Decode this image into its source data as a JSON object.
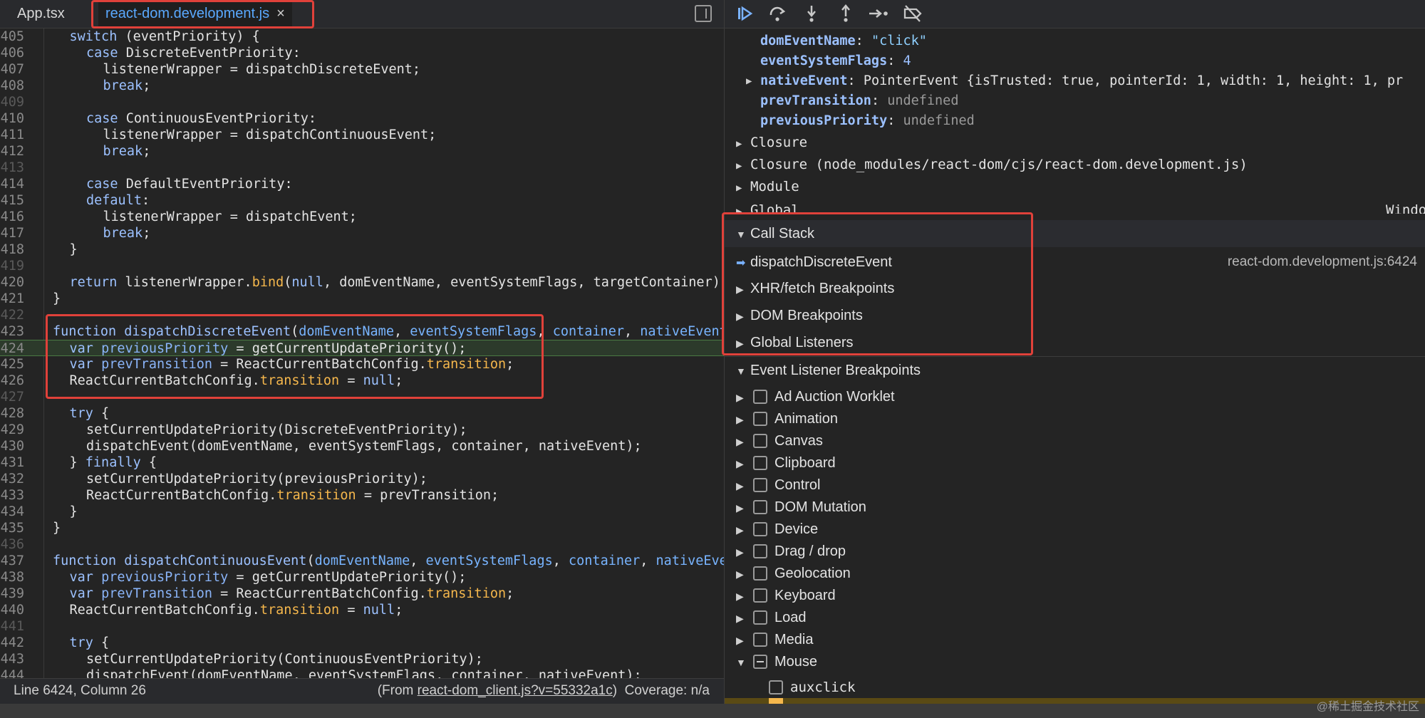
{
  "tabs": [
    {
      "label": "App.tsx"
    },
    {
      "label": "react-dom.development.js",
      "close": "×"
    }
  ],
  "code_lines": [
    {
      "n": "405",
      "html": "<span class=\"kw\">switch</span> (eventPriority) {",
      "indent": 1
    },
    {
      "n": "406",
      "html": "<span class=\"kw\">case</span> DiscreteEventPriority:",
      "indent": 2
    },
    {
      "n": "407",
      "html": "listenerWrapper = dispatchDiscreteEvent;",
      "indent": 3
    },
    {
      "n": "408",
      "html": "<span class=\"kw\">break</span>;",
      "indent": 3
    },
    {
      "n": "409",
      "html": "",
      "indent": 0,
      "dim": true
    },
    {
      "n": "410",
      "html": "<span class=\"kw\">case</span> ContinuousEventPriority:",
      "indent": 2
    },
    {
      "n": "411",
      "html": "listenerWrapper = dispatchContinuousEvent;",
      "indent": 3
    },
    {
      "n": "412",
      "html": "<span class=\"kw\">break</span>;",
      "indent": 3
    },
    {
      "n": "413",
      "html": "",
      "indent": 0,
      "dim": true
    },
    {
      "n": "414",
      "html": "<span class=\"kw\">case</span> DefaultEventPriority:",
      "indent": 2
    },
    {
      "n": "415",
      "html": "<span class=\"kw\">default</span>:",
      "indent": 2
    },
    {
      "n": "416",
      "html": "listenerWrapper = dispatchEvent;",
      "indent": 3
    },
    {
      "n": "417",
      "html": "<span class=\"kw\">break</span>;",
      "indent": 3
    },
    {
      "n": "418",
      "html": "}",
      "indent": 1
    },
    {
      "n": "419",
      "html": "",
      "indent": 0,
      "dim": true
    },
    {
      "n": "420",
      "html": "<span class=\"kw\">return</span> listenerWrapper.<span class=\"prop\">bind</span>(<span class=\"lit\">null</span>, domEventName, eventSystemFlags, targetContainer);",
      "indent": 1
    },
    {
      "n": "421",
      "html": "}",
      "indent": 0
    },
    {
      "n": "422",
      "html": "",
      "indent": 0,
      "dim": true
    },
    {
      "n": "423",
      "html": "<span class=\"kw\">function</span> <span class=\"fn\">dispatchDiscreteEvent</span>(<span class=\"prm\">domEventName</span>, <span class=\"prm\">eventSystemFlags</span>, <span class=\"prm\">container</span>, <span class=\"prm\">nativeEvent</span>) {",
      "indent": 0
    },
    {
      "n": "424",
      "html": "<span class=\"kw\">var</span> <span class=\"vr\">previousPriority</span> = getCurrentUpdatePriority();",
      "indent": 1,
      "exec": true
    },
    {
      "n": "425",
      "html": "<span class=\"kw\">var</span> <span class=\"vr\">prevTransition</span> = ReactCurrentBatchConfig.<span class=\"prop\">transition</span>;",
      "indent": 1
    },
    {
      "n": "426",
      "html": "ReactCurrentBatchConfig.<span class=\"prop\">transition</span> = <span class=\"lit\">null</span>;",
      "indent": 1
    },
    {
      "n": "427",
      "html": "",
      "indent": 0,
      "dim": true
    },
    {
      "n": "428",
      "html": "<span class=\"kw\">try</span> {",
      "indent": 1
    },
    {
      "n": "429",
      "html": "setCurrentUpdatePriority(DiscreteEventPriority);",
      "indent": 2
    },
    {
      "n": "430",
      "html": "dispatchEvent(domEventName, eventSystemFlags, container, nativeEvent);",
      "indent": 2
    },
    {
      "n": "431",
      "html": "} <span class=\"kw\">finally</span> {",
      "indent": 1
    },
    {
      "n": "432",
      "html": "setCurrentUpdatePriority(previousPriority);",
      "indent": 2
    },
    {
      "n": "433",
      "html": "ReactCurrentBatchConfig.<span class=\"prop\">transition</span> = prevTransition;",
      "indent": 2
    },
    {
      "n": "434",
      "html": "}",
      "indent": 1
    },
    {
      "n": "435",
      "html": "}",
      "indent": 0
    },
    {
      "n": "436",
      "html": "",
      "indent": 0,
      "dim": true
    },
    {
      "n": "437",
      "html": "<span class=\"kw\">function</span> <span class=\"fn\">dispatchContinuousEvent</span>(<span class=\"prm\">domEventName</span>, <span class=\"prm\">eventSystemFlags</span>, <span class=\"prm\">container</span>, <span class=\"prm\">nativeEvent</span>) {",
      "indent": 0
    },
    {
      "n": "438",
      "html": "<span class=\"kw\">var</span> <span class=\"vr\">previousPriority</span> = getCurrentUpdatePriority();",
      "indent": 1
    },
    {
      "n": "439",
      "html": "<span class=\"kw\">var</span> <span class=\"vr\">prevTransition</span> = ReactCurrentBatchConfig.<span class=\"prop\">transition</span>;",
      "indent": 1
    },
    {
      "n": "440",
      "html": "ReactCurrentBatchConfig.<span class=\"prop\">transition</span> = <span class=\"lit\">null</span>;",
      "indent": 1
    },
    {
      "n": "441",
      "html": "",
      "indent": 0,
      "dim": true
    },
    {
      "n": "442",
      "html": "<span class=\"kw\">try</span> {",
      "indent": 1
    },
    {
      "n": "443",
      "html": "setCurrentUpdatePriority(ContinuousEventPriority);",
      "indent": 2
    },
    {
      "n": "444",
      "html": "dispatchEvent(domEventName, eventSystemFlags, container, nativeEvent);",
      "indent": 2
    }
  ],
  "status": {
    "position": "Line 6424, Column 26",
    "from_prefix": "(From ",
    "from_link": "react-dom_client.js?v=55332a1c",
    "from_suffix": ")",
    "coverage": "Coverage: n/a"
  },
  "toolbar": {
    "resume_icon": "resume-icon",
    "step_over_icon": "step-over-icon",
    "step_into_icon": "step-into-icon",
    "step_out_icon": "step-out-icon",
    "step_icon": "step-icon",
    "deactivate_icon": "deactivate-breakpoints-icon"
  },
  "scope": {
    "vars": [
      {
        "key": "domEventName",
        "value": "\"click\"",
        "type": "str"
      },
      {
        "key": "eventSystemFlags",
        "value": "4",
        "type": "num"
      },
      {
        "key": "nativeEvent",
        "value": "PointerEvent {isTrusted: true, pointerId: 1, width: 1, height: 1, pr",
        "type": "obj",
        "expandable": true
      },
      {
        "key": "prevTransition",
        "value": "undefined",
        "type": "und"
      },
      {
        "key": "previousPriority",
        "value": "undefined",
        "type": "und"
      }
    ],
    "groups": [
      {
        "label": "Closure"
      },
      {
        "label": "Closure (node_modules/react-dom/cjs/react-dom.development.js)"
      },
      {
        "label": "Module"
      },
      {
        "label": "Global"
      }
    ],
    "global_value": "Windo"
  },
  "call_stack": {
    "title": "Call Stack",
    "frames": [
      {
        "name": "dispatchDiscreteEvent",
        "location": "react-dom.development.js:6424"
      }
    ]
  },
  "breakpoint_sections": [
    {
      "label": "XHR/fetch Breakpoints"
    },
    {
      "label": "DOM Breakpoints"
    },
    {
      "label": "Global Listeners"
    }
  ],
  "event_listener_breakpoints": {
    "title": "Event Listener Breakpoints",
    "items": [
      {
        "label": "Ad Auction Worklet"
      },
      {
        "label": "Animation"
      },
      {
        "label": "Canvas"
      },
      {
        "label": "Clipboard"
      },
      {
        "label": "Control"
      },
      {
        "label": "DOM Mutation"
      },
      {
        "label": "Device"
      },
      {
        "label": "Drag / drop"
      },
      {
        "label": "Geolocation"
      },
      {
        "label": "Keyboard"
      },
      {
        "label": "Load"
      },
      {
        "label": "Media"
      },
      {
        "label": "Mouse",
        "expanded": true,
        "partial": true
      }
    ],
    "mouse_children": [
      {
        "label": "auxclick"
      }
    ]
  },
  "watermark": "@稀土掘金技术社区"
}
